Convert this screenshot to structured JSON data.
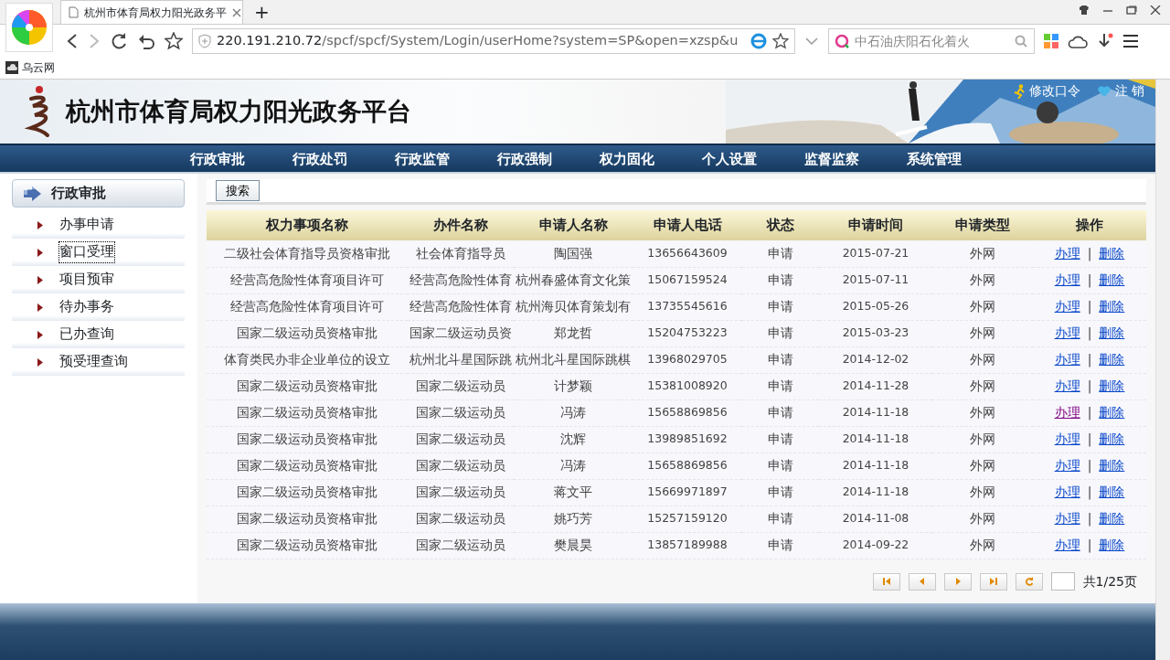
{
  "browser": {
    "tab_title": "杭州市体育局权力阳光政务平",
    "new_tab": "+",
    "address_host": "220.191.210.72",
    "address_path": "/spcf/spcf/System/Login/userHome?system=SP&open=xzsp&u",
    "search_placeholder": "中石油庆阳石化着火",
    "bookmarks": [
      {
        "label": "乌云网"
      }
    ]
  },
  "header": {
    "title": "杭州市体育局权力阳光政务平台",
    "links": [
      {
        "kind": "runner",
        "label": "修改口令"
      },
      {
        "kind": "heart",
        "label": "注 销"
      }
    ]
  },
  "nav": [
    "行政审批",
    "行政处罚",
    "行政监管",
    "行政强制",
    "权力固化",
    "个人设置",
    "监督监察",
    "系统管理"
  ],
  "sidebar": {
    "title": "行政审批",
    "items": [
      {
        "label": "办事申请",
        "focused": false
      },
      {
        "label": "窗口受理",
        "focused": true
      },
      {
        "label": "项目预审",
        "focused": false
      },
      {
        "label": "待办事务",
        "focused": false
      },
      {
        "label": "已办查询",
        "focused": false
      },
      {
        "label": "预受理查询",
        "focused": false
      }
    ]
  },
  "search_button": "搜索",
  "table": {
    "columns": [
      "权力事项名称",
      "办件名称",
      "申请人名称",
      "申请人电话",
      "状态",
      "申请时间",
      "申请类型",
      "操作"
    ],
    "rows": [
      {
        "cells": [
          "二级社会体育指导员资格审批",
          "社会体育指导员",
          "陶国强",
          "13656643609",
          "申请",
          "2015-07-21",
          "外网"
        ],
        "separator": "|",
        "actions": [
          {
            "label": "办理",
            "visited": false
          },
          {
            "label": "删除",
            "visited": false
          }
        ]
      },
      {
        "cells": [
          "经营高危险性体育项目许可",
          "经营高危险性体育",
          "杭州春盛体育文化策",
          "15067159524",
          "申请",
          "2015-07-11",
          "外网"
        ],
        "separator": "|",
        "actions": [
          {
            "label": "办理",
            "visited": false
          },
          {
            "label": "删除",
            "visited": false
          }
        ]
      },
      {
        "cells": [
          "经营高危险性体育项目许可",
          "经营高危险性体育",
          "杭州海贝体育策划有",
          "13735545616",
          "申请",
          "2015-05-26",
          "外网"
        ],
        "separator": "|",
        "actions": [
          {
            "label": "办理",
            "visited": false
          },
          {
            "label": "删除",
            "visited": false
          }
        ]
      },
      {
        "cells": [
          "国家二级运动员资格审批",
          "国家二级运动员资",
          "郑龙哲",
          "15204753223",
          "申请",
          "2015-03-23",
          "外网"
        ],
        "separator": "|",
        "actions": [
          {
            "label": "办理",
            "visited": false
          },
          {
            "label": "删除",
            "visited": false
          }
        ]
      },
      {
        "cells": [
          "体育类民办非企业单位的设立",
          "杭州北斗星国际跳",
          "杭州北斗星国际跳棋",
          "13968029705",
          "申请",
          "2014-12-02",
          "外网"
        ],
        "separator": "|",
        "actions": [
          {
            "label": "办理",
            "visited": false
          },
          {
            "label": "删除",
            "visited": false
          }
        ]
      },
      {
        "cells": [
          "国家二级运动员资格审批",
          "国家二级运动员",
          "计梦颖",
          "15381008920",
          "申请",
          "2014-11-28",
          "外网"
        ],
        "separator": "|",
        "actions": [
          {
            "label": "办理",
            "visited": false
          },
          {
            "label": "删除",
            "visited": false
          }
        ]
      },
      {
        "cells": [
          "国家二级运动员资格审批",
          "国家二级运动员",
          "冯涛",
          "15658869856",
          "申请",
          "2014-11-18",
          "外网"
        ],
        "separator": "|",
        "actions": [
          {
            "label": "办理",
            "visited": true
          },
          {
            "label": "删除",
            "visited": false
          }
        ]
      },
      {
        "cells": [
          "国家二级运动员资格审批",
          "国家二级运动员",
          "沈辉",
          "13989851692",
          "申请",
          "2014-11-18",
          "外网"
        ],
        "separator": "|",
        "actions": [
          {
            "label": "办理",
            "visited": false
          },
          {
            "label": "删除",
            "visited": false
          }
        ]
      },
      {
        "cells": [
          "国家二级运动员资格审批",
          "国家二级运动员",
          "冯涛",
          "15658869856",
          "申请",
          "2014-11-18",
          "外网"
        ],
        "separator": "|",
        "actions": [
          {
            "label": "办理",
            "visited": false
          },
          {
            "label": "删除",
            "visited": false
          }
        ]
      },
      {
        "cells": [
          "国家二级运动员资格审批",
          "国家二级运动员",
          "蒋文平",
          "15669971897",
          "申请",
          "2014-11-18",
          "外网"
        ],
        "separator": "|",
        "actions": [
          {
            "label": "办理",
            "visited": false
          },
          {
            "label": "删除",
            "visited": false
          }
        ]
      },
      {
        "cells": [
          "国家二级运动员资格审批",
          "国家二级运动员",
          "姚巧芳",
          "15257159120",
          "申请",
          "2014-11-08",
          "外网"
        ],
        "separator": "|",
        "actions": [
          {
            "label": "办理",
            "visited": false
          },
          {
            "label": "删除",
            "visited": false
          }
        ]
      },
      {
        "cells": [
          "国家二级运动员资格审批",
          "国家二级运动员",
          "樊晨昊",
          "13857189988",
          "申请",
          "2014-09-22",
          "外网"
        ],
        "separator": "|",
        "actions": [
          {
            "label": "办理",
            "visited": false
          },
          {
            "label": "删除",
            "visited": false
          }
        ]
      }
    ]
  },
  "pager": {
    "buttons": [
      {
        "kind": "first"
      },
      {
        "kind": "prev"
      },
      {
        "kind": "next"
      },
      {
        "kind": "last"
      },
      {
        "kind": "refresh"
      }
    ],
    "page_info": "共1/25页"
  }
}
